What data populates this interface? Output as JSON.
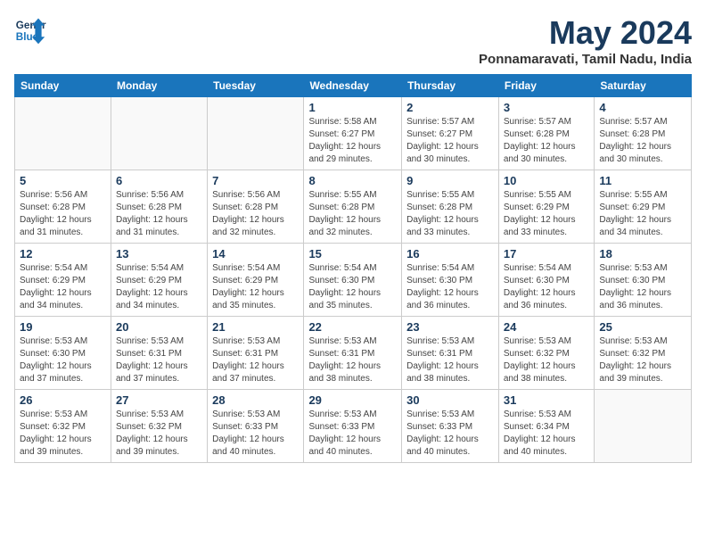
{
  "logo": {
    "line1": "General",
    "line2": "Blue"
  },
  "title": "May 2024",
  "location": "Ponnamaravati, Tamil Nadu, India",
  "weekdays": [
    "Sunday",
    "Monday",
    "Tuesday",
    "Wednesday",
    "Thursday",
    "Friday",
    "Saturday"
  ],
  "weeks": [
    [
      {
        "day": "",
        "info": ""
      },
      {
        "day": "",
        "info": ""
      },
      {
        "day": "",
        "info": ""
      },
      {
        "day": "1",
        "info": "Sunrise: 5:58 AM\nSunset: 6:27 PM\nDaylight: 12 hours\nand 29 minutes."
      },
      {
        "day": "2",
        "info": "Sunrise: 5:57 AM\nSunset: 6:27 PM\nDaylight: 12 hours\nand 30 minutes."
      },
      {
        "day": "3",
        "info": "Sunrise: 5:57 AM\nSunset: 6:28 PM\nDaylight: 12 hours\nand 30 minutes."
      },
      {
        "day": "4",
        "info": "Sunrise: 5:57 AM\nSunset: 6:28 PM\nDaylight: 12 hours\nand 30 minutes."
      }
    ],
    [
      {
        "day": "5",
        "info": "Sunrise: 5:56 AM\nSunset: 6:28 PM\nDaylight: 12 hours\nand 31 minutes."
      },
      {
        "day": "6",
        "info": "Sunrise: 5:56 AM\nSunset: 6:28 PM\nDaylight: 12 hours\nand 31 minutes."
      },
      {
        "day": "7",
        "info": "Sunrise: 5:56 AM\nSunset: 6:28 PM\nDaylight: 12 hours\nand 32 minutes."
      },
      {
        "day": "8",
        "info": "Sunrise: 5:55 AM\nSunset: 6:28 PM\nDaylight: 12 hours\nand 32 minutes."
      },
      {
        "day": "9",
        "info": "Sunrise: 5:55 AM\nSunset: 6:28 PM\nDaylight: 12 hours\nand 33 minutes."
      },
      {
        "day": "10",
        "info": "Sunrise: 5:55 AM\nSunset: 6:29 PM\nDaylight: 12 hours\nand 33 minutes."
      },
      {
        "day": "11",
        "info": "Sunrise: 5:55 AM\nSunset: 6:29 PM\nDaylight: 12 hours\nand 34 minutes."
      }
    ],
    [
      {
        "day": "12",
        "info": "Sunrise: 5:54 AM\nSunset: 6:29 PM\nDaylight: 12 hours\nand 34 minutes."
      },
      {
        "day": "13",
        "info": "Sunrise: 5:54 AM\nSunset: 6:29 PM\nDaylight: 12 hours\nand 34 minutes."
      },
      {
        "day": "14",
        "info": "Sunrise: 5:54 AM\nSunset: 6:29 PM\nDaylight: 12 hours\nand 35 minutes."
      },
      {
        "day": "15",
        "info": "Sunrise: 5:54 AM\nSunset: 6:30 PM\nDaylight: 12 hours\nand 35 minutes."
      },
      {
        "day": "16",
        "info": "Sunrise: 5:54 AM\nSunset: 6:30 PM\nDaylight: 12 hours\nand 36 minutes."
      },
      {
        "day": "17",
        "info": "Sunrise: 5:54 AM\nSunset: 6:30 PM\nDaylight: 12 hours\nand 36 minutes."
      },
      {
        "day": "18",
        "info": "Sunrise: 5:53 AM\nSunset: 6:30 PM\nDaylight: 12 hours\nand 36 minutes."
      }
    ],
    [
      {
        "day": "19",
        "info": "Sunrise: 5:53 AM\nSunset: 6:30 PM\nDaylight: 12 hours\nand 37 minutes."
      },
      {
        "day": "20",
        "info": "Sunrise: 5:53 AM\nSunset: 6:31 PM\nDaylight: 12 hours\nand 37 minutes."
      },
      {
        "day": "21",
        "info": "Sunrise: 5:53 AM\nSunset: 6:31 PM\nDaylight: 12 hours\nand 37 minutes."
      },
      {
        "day": "22",
        "info": "Sunrise: 5:53 AM\nSunset: 6:31 PM\nDaylight: 12 hours\nand 38 minutes."
      },
      {
        "day": "23",
        "info": "Sunrise: 5:53 AM\nSunset: 6:31 PM\nDaylight: 12 hours\nand 38 minutes."
      },
      {
        "day": "24",
        "info": "Sunrise: 5:53 AM\nSunset: 6:32 PM\nDaylight: 12 hours\nand 38 minutes."
      },
      {
        "day": "25",
        "info": "Sunrise: 5:53 AM\nSunset: 6:32 PM\nDaylight: 12 hours\nand 39 minutes."
      }
    ],
    [
      {
        "day": "26",
        "info": "Sunrise: 5:53 AM\nSunset: 6:32 PM\nDaylight: 12 hours\nand 39 minutes."
      },
      {
        "day": "27",
        "info": "Sunrise: 5:53 AM\nSunset: 6:32 PM\nDaylight: 12 hours\nand 39 minutes."
      },
      {
        "day": "28",
        "info": "Sunrise: 5:53 AM\nSunset: 6:33 PM\nDaylight: 12 hours\nand 40 minutes."
      },
      {
        "day": "29",
        "info": "Sunrise: 5:53 AM\nSunset: 6:33 PM\nDaylight: 12 hours\nand 40 minutes."
      },
      {
        "day": "30",
        "info": "Sunrise: 5:53 AM\nSunset: 6:33 PM\nDaylight: 12 hours\nand 40 minutes."
      },
      {
        "day": "31",
        "info": "Sunrise: 5:53 AM\nSunset: 6:34 PM\nDaylight: 12 hours\nand 40 minutes."
      },
      {
        "day": "",
        "info": ""
      }
    ]
  ]
}
